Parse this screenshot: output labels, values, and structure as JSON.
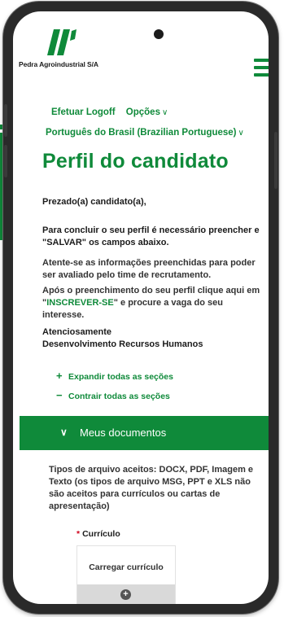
{
  "brand": {
    "name": "Pedra Agroindustrial S/A",
    "accent": "#0f8a3a"
  },
  "nav": {
    "logoff": "Efetuar Logoff",
    "options": "Opções",
    "language": "Português do Brasil (Brazilian Portuguese)"
  },
  "page": {
    "title": "Perfil do candidato",
    "greeting": "Prezado(a) candidato(a),",
    "intro_bold": "Para concluir o seu perfil é necessário preencher e \"SALVAR\" os campos abaixo.",
    "attention": "Atente-se as informações preenchidas para poder ser avaliado pelo time de recrutamento.",
    "after_prefix": "Após o preenchimento do seu perfil clique aqui em \"",
    "after_link": "INSCREVER-SE",
    "after_suffix": "\" e procure a vaga do seu interesse.",
    "sign_line1": "Atenciosamente",
    "sign_line2": "Desenvolvimento Recursos Humanos"
  },
  "controls": {
    "expand_all": "Expandir todas as seções",
    "collapse_all": "Contrair todas as seções"
  },
  "section": {
    "title": "Meus documentos",
    "file_types": "Tipos de arquivo aceitos: DOCX, PDF, Imagem e Texto (os tipos de arquivo MSG, PPT e XLS não são aceitos para currículos ou cartas de apresentação)",
    "required_mark": "*",
    "field_label": "Currículo",
    "upload_label": "Carregar currículo"
  },
  "icons": {
    "menu": "hamburger-menu-icon",
    "chevron": "chevron-down-icon",
    "plus": "plus-icon",
    "minus": "minus-icon",
    "upload": "plus-circle-icon"
  }
}
